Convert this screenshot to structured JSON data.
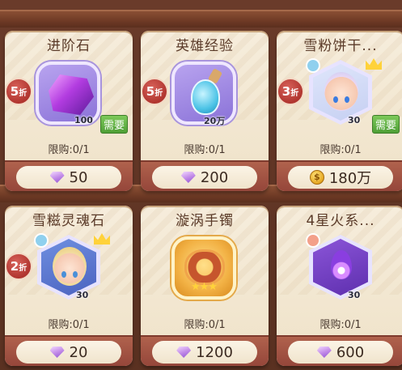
{
  "shop": {
    "items": [
      {
        "title": "进阶石",
        "discount": "5",
        "discount_unit": "折",
        "quantity": "100",
        "need_label": "需要",
        "limit": "限购:0/1",
        "price": "50",
        "currency_icon": "diamond-icon",
        "item_icon": "purple-crystal-icon"
      },
      {
        "title": "英雄经验",
        "discount": "5",
        "discount_unit": "折",
        "quantity": "20万",
        "limit": "限购:0/1",
        "price": "200",
        "currency_icon": "diamond-icon",
        "item_icon": "potion-bottle-icon"
      },
      {
        "title": "雪粉饼干...",
        "discount": "3",
        "discount_unit": "折",
        "quantity": "30",
        "need_label": "需要",
        "limit": "限购:0/1",
        "price": "180万",
        "currency_icon": "gold-coin-icon",
        "item_icon": "hero-portrait-icon"
      },
      {
        "title": "雪糍灵魂石",
        "discount": "2",
        "discount_unit": "折",
        "quantity": "30",
        "limit": "限购:0/1",
        "price": "20",
        "currency_icon": "diamond-icon",
        "item_icon": "hero-soulstone-icon"
      },
      {
        "title": "漩涡手镯",
        "limit": "限购:0/1",
        "price": "1200",
        "currency_icon": "diamond-icon",
        "item_icon": "bracelet-icon"
      },
      {
        "title": "4星火系...",
        "quantity": "30",
        "limit": "限购:0/1",
        "price": "600",
        "currency_icon": "diamond-icon",
        "item_icon": "fire-element-icon"
      }
    ]
  },
  "colors": {
    "card_bg": "#f6eddc",
    "price_bar": "#b0624d",
    "discount_badge": "#b0352f",
    "need_badge": "#5aab3e",
    "gem_purple": "#c28be8",
    "coin_gold": "#e6a822"
  }
}
